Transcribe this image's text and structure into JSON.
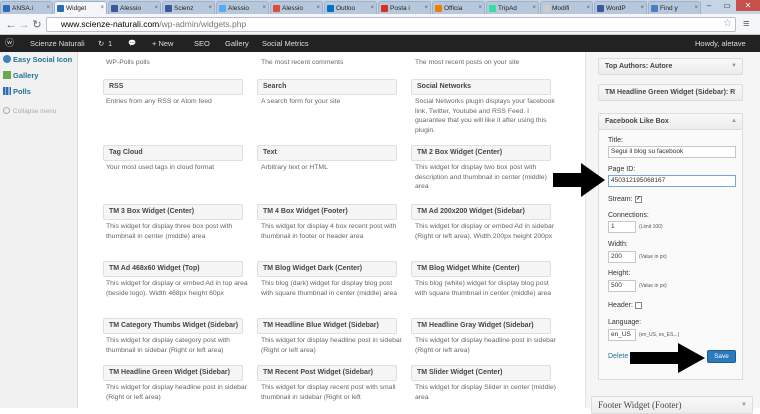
{
  "browser": {
    "tabs": [
      {
        "label": "ANSA.i",
        "icon": "ansa-icon",
        "color": "#2a6db5"
      },
      {
        "label": "Widget",
        "icon": "wordpress-icon",
        "color": "#2a6db5",
        "active": true
      },
      {
        "label": "Alessio",
        "icon": "facebook-icon",
        "color": "#3b5998"
      },
      {
        "label": "Scienz",
        "icon": "facebook-icon",
        "color": "#3b5998"
      },
      {
        "label": "Alessio",
        "icon": "twitter-icon",
        "color": "#55acee"
      },
      {
        "label": "Alessio",
        "icon": "googleplus-icon",
        "color": "#dd4b39"
      },
      {
        "label": "Outloo",
        "icon": "outlook-icon",
        "color": "#0072c6"
      },
      {
        "label": "Posta i",
        "icon": "gmail-icon",
        "color": "#d93025"
      },
      {
        "label": "Officia",
        "icon": "blogger-icon",
        "color": "#f57d00"
      },
      {
        "label": "TripAd",
        "icon": "tripadvisor-icon",
        "color": "#34e0a1"
      },
      {
        "label": "Modifi",
        "icon": "document-icon",
        "color": "#cccccc"
      },
      {
        "label": "WordP",
        "icon": "facebook-icon",
        "color": "#3b5998"
      },
      {
        "label": "Find y",
        "icon": "page-icon",
        "color": "#4a7fc1"
      }
    ],
    "url_domain": "www.scienze-naturali.com",
    "url_path": "/wp-admin/widgets.php"
  },
  "adminbar": {
    "wp_logo": "ⓦ",
    "site_name": "Scienze Naturali",
    "updates_count": "1",
    "comments_icon": "💬",
    "new_label": "+ New",
    "seo_label": "SEO",
    "gallery_label": "Gallery",
    "social_metrics_label": "Social Metrics",
    "howdy": "Howdy, aletave"
  },
  "leftmenu": {
    "items": [
      {
        "label": "Easy Social Icon",
        "icon": "social-icon"
      },
      {
        "label": "Gallery",
        "icon": "gallery-icon"
      },
      {
        "label": "Polls",
        "icon": "polls-icon"
      }
    ],
    "collapse_label": "Collapse menu"
  },
  "widgets": {
    "top_row_desc": [
      "WP-Polls polls",
      "The most recent comments",
      "The most recent posts on your site"
    ],
    "items": [
      {
        "title": "RSS",
        "desc": "Entries from any RSS or Atom feed"
      },
      {
        "title": "Search",
        "desc": "A search form for your site"
      },
      {
        "title": "Social Networks",
        "desc": "Social Networks plugin displays your facebook link, Twitter, Youtube and RSS Feed. I guarantee that you will like it after using this plugin."
      },
      {
        "title": "Tag Cloud",
        "desc": "Your most used tags in cloud format"
      },
      {
        "title": "Text",
        "desc": "Arbitrary text or HTML"
      },
      {
        "title": "TM 2 Box Widget (Center)",
        "desc": "This widget for display two box post with description and thumbnail in center (middle) area"
      },
      {
        "title": "TM 3 Box Widget (Center)",
        "desc": "This widget for display three box post with thumbnail in center (middle) area"
      },
      {
        "title": "TM 4 Box Widget (Footer)",
        "desc": "This widget for display 4 box recent post with thumbnail in footer or header area"
      },
      {
        "title": "TM Ad 200x200 Widget (Sidebar)",
        "desc": "This widget for display or embed Ad in sidebar (Right or left area). Width 200px height 200px"
      },
      {
        "title": "TM Ad 468x60 Widget (Top)",
        "desc": "This widget for display or embed Ad in top area (beside logo). Width 468px height 60px"
      },
      {
        "title": "TM Blog Widget Dark (Center)",
        "desc": "This blog (dark) widget for display blog post with square thumbnail in center (middle) area"
      },
      {
        "title": "TM Blog Widget White (Center)",
        "desc": "This blog (white) widget for display blog post with square thumbnail in center (middle) area"
      },
      {
        "title": "TM Category Thumbs Widget (Sidebar)",
        "desc": "This widget for display category post with thumbnail in sidebar (Right or left area)"
      },
      {
        "title": "TM Headline Blue Widget (Sidebar)",
        "desc": "This widget for display headline post in sidebar (Right or left area)"
      },
      {
        "title": "TM Headline Gray Widget (Sidebar)",
        "desc": "This widget for display headline post in sidebar (Right or left area)"
      },
      {
        "title": "TM Headline Green Widget (Sidebar)",
        "desc": "This widget for display headline post in sidebar (Right or left area)"
      },
      {
        "title": "TM Recent Post Widget (Sidebar)",
        "desc": "This widget for display recent post with small thumbnail in sidebar (Right or left"
      },
      {
        "title": "TM Slider Widget (Center)",
        "desc": "This widget for display Slider in center (middle) area"
      }
    ]
  },
  "sidebar": {
    "boxes": [
      "Top Authors: Autore",
      "TM Headline Green Widget (Sidebar): R",
      "Facebook Like Box"
    ],
    "form": {
      "title_label": "Title:",
      "title_value": "Segui il blog su facebook",
      "pageid_label": "Page ID:",
      "pageid_value": "450312195068167",
      "stream_label": "Stream:",
      "connections_label": "Connections:",
      "connections_value": "1",
      "connections_hint": "(Limit 100)",
      "width_label": "Width:",
      "width_value": "200",
      "width_hint": "(Value in px)",
      "height_label": "Height:",
      "height_value": "500",
      "height_hint": "(Value in px)",
      "header_label": "Header:",
      "language_label": "Language:",
      "language_value": "en_US",
      "language_hint": "(en_US, es_ES...)",
      "delete_label": "Delete |",
      "save_label": "Save"
    },
    "footer_widget": "Footer Widget (Footer)"
  }
}
